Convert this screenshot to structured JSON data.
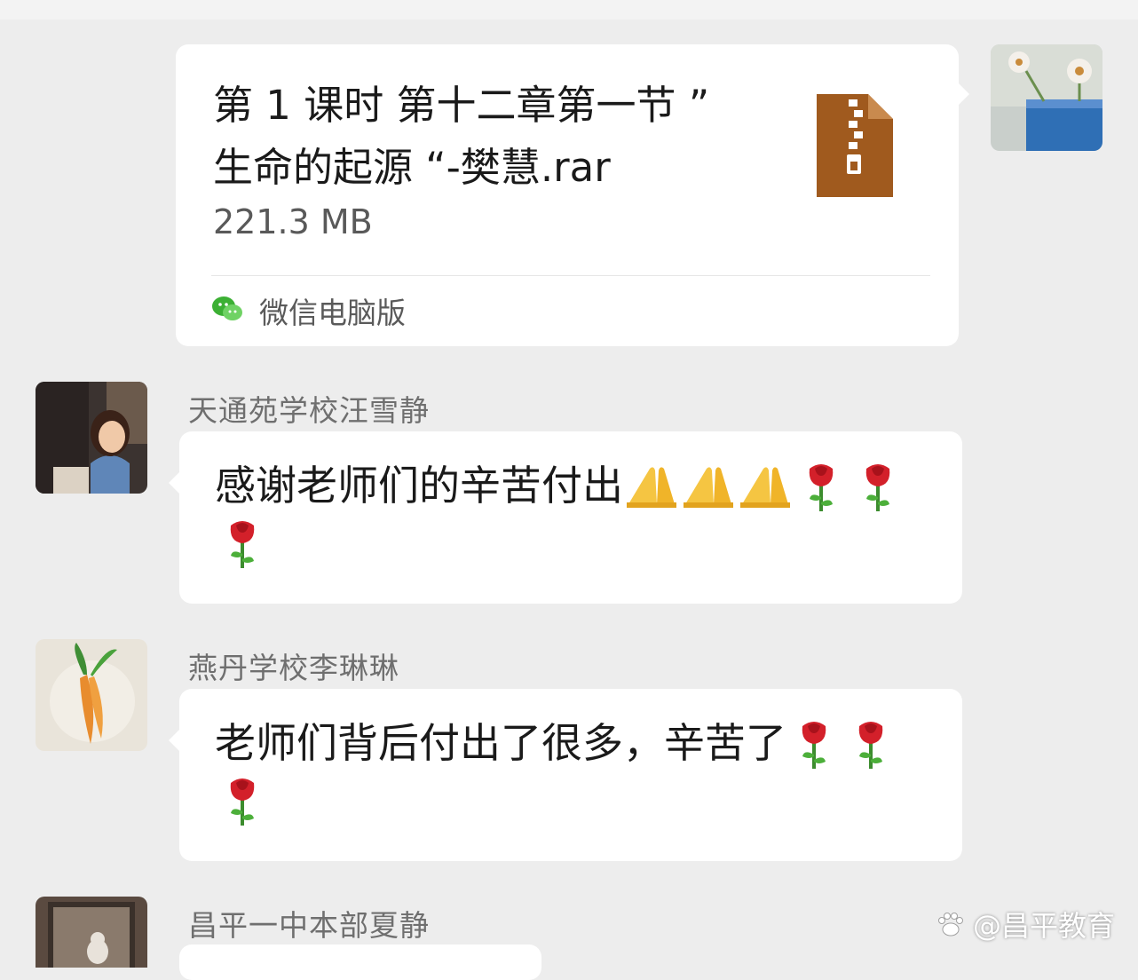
{
  "file_message": {
    "file_name": "第 1 课时 第十二章第一节 ”\n生命的起源 “-樊慧.rar",
    "file_size": "221.3 MB",
    "source_label": "微信电脑版"
  },
  "messages": [
    {
      "sender": "天通苑学校汪雪静",
      "text": "感谢老师们的辛苦付出",
      "emojis": [
        "pray-emoji",
        "pray-emoji",
        "pray-emoji",
        "rose-emoji",
        "rose-emoji",
        "rose-emoji"
      ]
    },
    {
      "sender": "燕丹学校李琳琳",
      "text": "老师们背后付出了很多，辛苦了",
      "emojis": [
        "rose-emoji",
        "rose-emoji",
        "rose-emoji"
      ]
    },
    {
      "sender": "昌平一中本部夏静"
    }
  ],
  "watermark": {
    "text": "@昌平教育"
  },
  "colors": {
    "background": "#ededed",
    "bubble": "#ffffff",
    "archive_icon": "#a05a1e",
    "wechat_green": "#3cb034"
  }
}
